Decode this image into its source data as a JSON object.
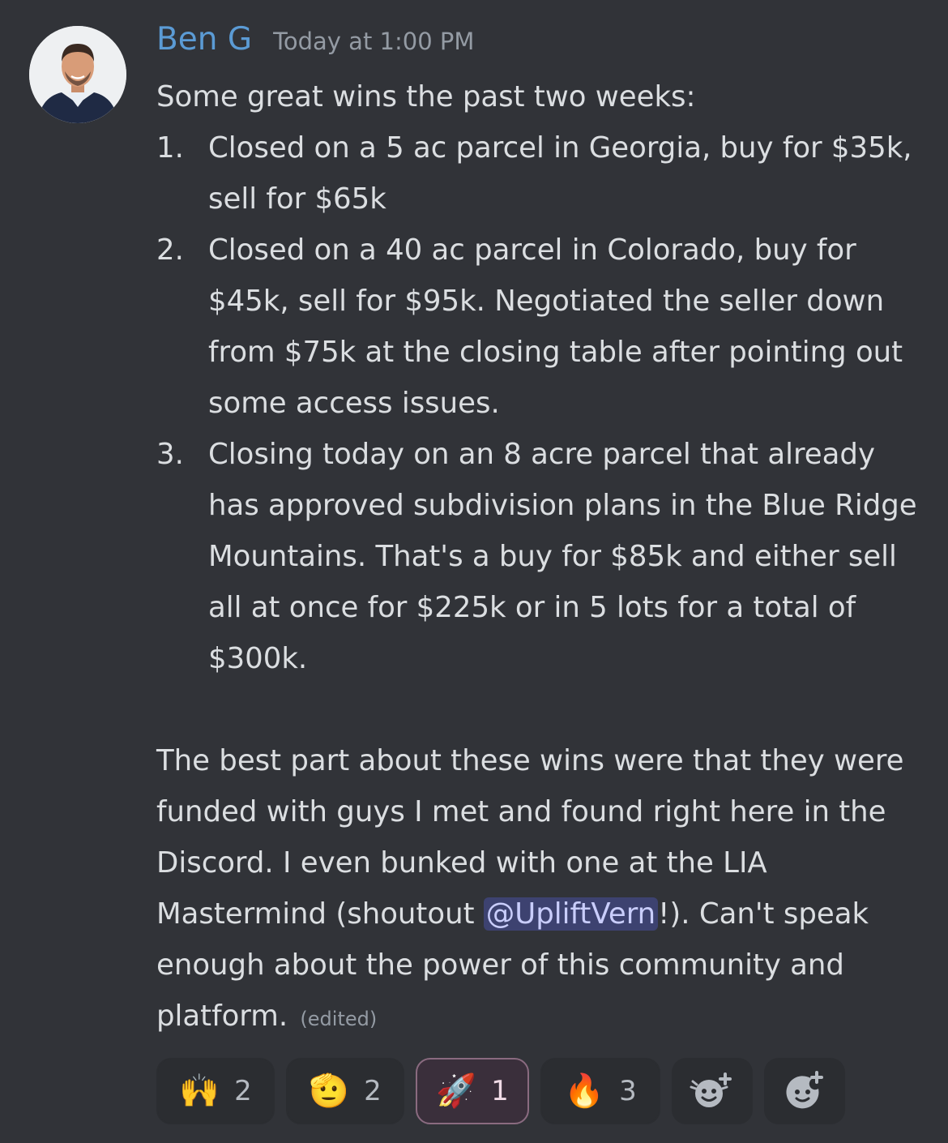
{
  "message": {
    "author": "Ben G",
    "timestamp": "Today at 1:00 PM",
    "intro": "Some great wins the past two weeks:",
    "wins": [
      {
        "number": "1.",
        "text": "Closed on a 5 ac parcel in Georgia, buy for $35k, sell for $65k"
      },
      {
        "number": "2.",
        "text": "Closed on a 40 ac parcel in Colorado, buy for $45k, sell for $95k. Negotiated the seller down from $75k at the closing table after pointing out some access issues."
      },
      {
        "number": "3.",
        "text": "Closing today on an 8 acre parcel that already has approved subdivision plans in the Blue Ridge Mountains. That's a buy for $85k and either sell all at once for $225k or in 5 lots for a total of $300k."
      }
    ],
    "outro_before_mention": "The best part about these wins were that they were funded with guys I met and found right here in the Discord. I even bunked with one at the LIA Mastermind (shoutout ",
    "mention": "@UpliftVern",
    "outro_after_mention": "!). Can't speak enough about the power of this community and platform.",
    "edited_label": "(edited)"
  },
  "reactions": [
    {
      "emoji": "🙌",
      "name": "raising-hands",
      "count": "2",
      "active": false
    },
    {
      "emoji": "🫡",
      "name": "saluting-face",
      "count": "2",
      "active": false
    },
    {
      "emoji": "🚀",
      "name": "rocket",
      "count": "1",
      "active": true
    },
    {
      "emoji": "🔥",
      "name": "fire",
      "count": "3",
      "active": false
    }
  ],
  "actions": [
    {
      "name": "add-super-reaction",
      "icon": "super-reaction-icon"
    },
    {
      "name": "add-reaction",
      "icon": "add-reaction-icon"
    }
  ],
  "colors": {
    "background": "#313338",
    "username": "#5b9bd5",
    "mention_bg": "#3d4270",
    "reaction_bg": "#2b2d31"
  }
}
